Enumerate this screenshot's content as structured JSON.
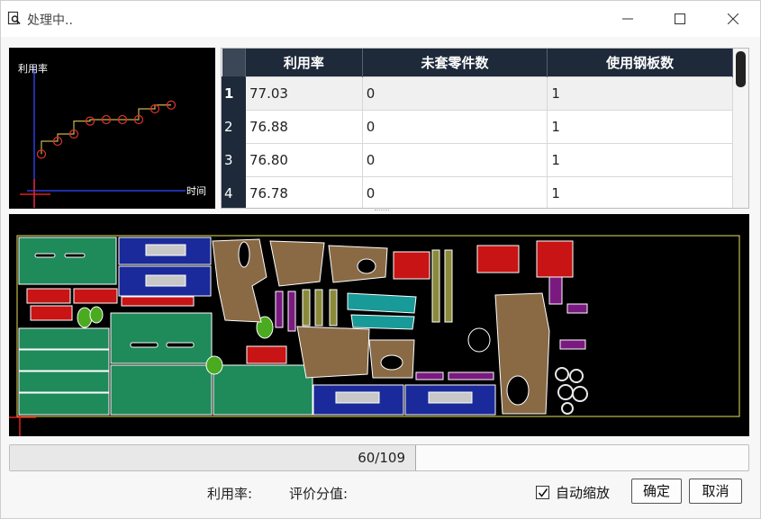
{
  "window": {
    "title": "处理中..",
    "icon": "search-document-icon",
    "controls": [
      "minimize-icon",
      "maximize-icon",
      "close-icon"
    ]
  },
  "chart_data": {
    "type": "line",
    "xlabel": "时间",
    "ylabel": "利用率",
    "step": true,
    "x": [
      1,
      2,
      3,
      4,
      5,
      6,
      7,
      8,
      9
    ],
    "y": [
      70.2,
      72.0,
      73.0,
      74.8,
      75.0,
      75.0,
      75.0,
      76.5,
      77.03
    ],
    "line_color": "#c8b44a",
    "marker_color": "#e03030",
    "axis_color": "#2a3de0",
    "origin_color": "#e02020"
  },
  "table": {
    "columns": [
      "利用率",
      "未套零件数",
      "使用钢板数"
    ],
    "rows": [
      {
        "index": "1",
        "cells": [
          "77.03",
          "0",
          "1"
        ]
      },
      {
        "index": "2",
        "cells": [
          "76.88",
          "0",
          "1"
        ]
      },
      {
        "index": "3",
        "cells": [
          "76.80",
          "0",
          "1"
        ]
      },
      {
        "index": "4",
        "cells": [
          "76.78",
          "0",
          "1"
        ]
      }
    ],
    "selected_row": 0
  },
  "nesting_view": {
    "sheet_outline_color": "#e8e25a",
    "part_colors": {
      "green": "#1f8a5a",
      "navy": "#1a2a9a",
      "brown": "#8a6a45",
      "red": "#c81414",
      "teal": "#189a98",
      "purple": "#7a1a80",
      "olive": "#8a8a3a"
    }
  },
  "progress": {
    "text": "60/109",
    "value": 60,
    "max": 109
  },
  "footer": {
    "utilization_label": "利用率:",
    "score_label": "评价分值:",
    "auto_zoom_label": "自动缩放",
    "auto_zoom_checked": true,
    "ok_label": "确定",
    "cancel_label": "取消"
  }
}
